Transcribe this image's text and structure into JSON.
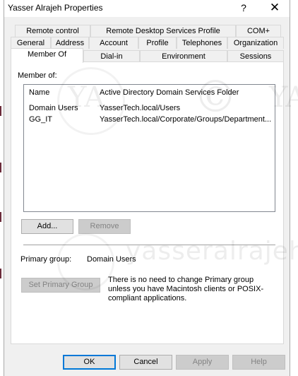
{
  "window": {
    "title": "Yasser Alrajeh Properties",
    "help_glyph": "?",
    "close_glyph": "✕"
  },
  "tabs": {
    "row1": [
      "Remote control",
      "Remote Desktop Services Profile",
      "COM+"
    ],
    "row2": [
      "General",
      "Address",
      "Account",
      "Profile",
      "Telephones",
      "Organization"
    ],
    "row3": [
      "Member Of",
      "Dial-in",
      "Environment",
      "Sessions"
    ],
    "active": "Member Of"
  },
  "member_of": {
    "label": "Member of:",
    "columns": {
      "name": "Name",
      "folder": "Active Directory Domain Services Folder"
    },
    "rows": [
      {
        "name": "Domain Users",
        "folder": "YasserTech.local/Users"
      },
      {
        "name": "GG_IT",
        "folder": "YasserTech.local/Corporate/Groups/Department..."
      }
    ],
    "add_button": "Add...",
    "remove_button": "Remove"
  },
  "primary_group": {
    "label": "Primary group:",
    "value": "Domain Users",
    "set_button": "Set Primary Group",
    "note": "There is no need to change Primary group unless you have Macintosh clients or POSIX-compliant applications."
  },
  "footer": {
    "ok": "OK",
    "cancel": "Cancel",
    "apply": "Apply",
    "help": "Help"
  },
  "watermark": {
    "monogram": "YA",
    "copyright": "©",
    "text": "yasseralrajeh"
  }
}
